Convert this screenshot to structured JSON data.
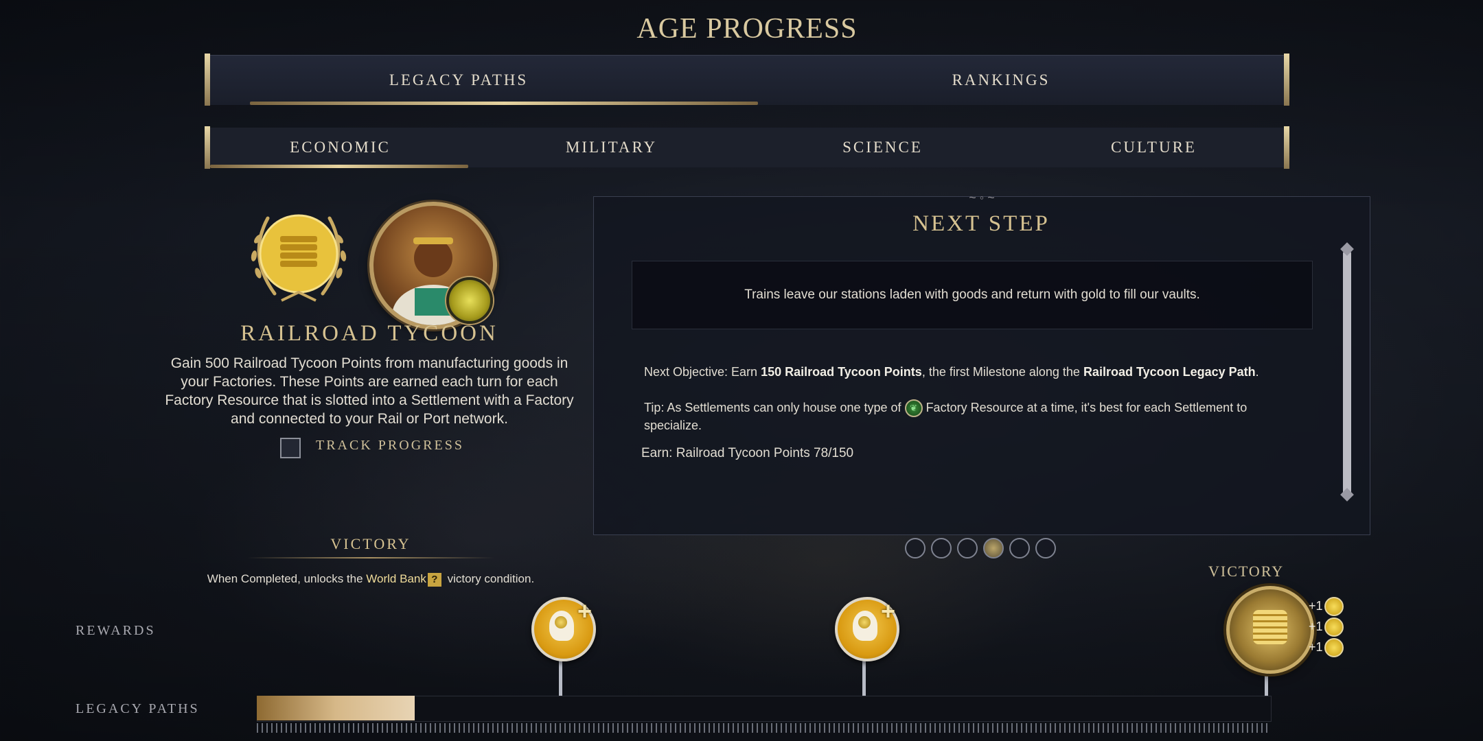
{
  "header": {
    "title": "AGE PROGRESS"
  },
  "main_tabs": [
    {
      "label": "LEGACY PATHS",
      "active": true
    },
    {
      "label": "RANKINGS",
      "active": false
    }
  ],
  "sub_tabs": [
    {
      "label": "ECONOMIC",
      "active": true
    },
    {
      "label": "MILITARY",
      "active": false
    },
    {
      "label": "SCIENCE",
      "active": false
    },
    {
      "label": "CULTURE",
      "active": false
    }
  ],
  "legacy": {
    "name": "RAILROAD TYCOON",
    "description": "Gain 500 Railroad Tycoon Points from manufacturing goods in your Factories. These Points are earned each turn for each Factory Resource that is slotted into a Settlement with a Factory and connected to your Rail or Port network.",
    "track_progress_label": "TRACK PROGRESS",
    "track_progress_checked": false,
    "medal_icon": "gold-coins-laurel-icon",
    "portrait_icon": "leader-portrait",
    "badge_icon": "economic-coin-badge-icon"
  },
  "victory": {
    "heading": "VICTORY",
    "desc_prefix": "When Completed, unlocks the ",
    "desc_link": "World Bank",
    "desc_help": "?",
    "desc_suffix": " victory condition."
  },
  "next_step": {
    "title": "NEXT STEP",
    "quote": "Trains leave our stations laden with goods and return with gold to fill our vaults.",
    "objective_prefix": "Next Objective: Earn ",
    "objective_bold1": "150 Railroad Tycoon Points",
    "objective_mid": ", the first Milestone along the ",
    "objective_bold2": "Railroad Tycoon Legacy Path",
    "objective_end": ".",
    "tip_prefix": "Tip: As Settlements can only house one type of ",
    "tip_icon": "factory-resource-leaf-icon",
    "tip_suffix": " Factory Resource at a time, it's best for each Settlement to specialize.",
    "earn": "Earn: Railroad Tycoon Points 78/150"
  },
  "pagination": {
    "count": 6,
    "active_index": 3
  },
  "rewards_row": {
    "label": "REWARDS",
    "reward_icon": "attribute-point-head-plus-icon",
    "victory_label": "VICTORY",
    "bonuses": [
      "+1",
      "+1",
      "+1"
    ],
    "bonus_icon": "legacy-point-coin-icon"
  },
  "legacy_paths_row": {
    "label": "LEGACY PATHS",
    "progress_current": 78,
    "progress_max": 500
  },
  "colors": {
    "accent_gold": "#d6c291",
    "background": "#171b24",
    "progress_fill": "#d6b888"
  }
}
